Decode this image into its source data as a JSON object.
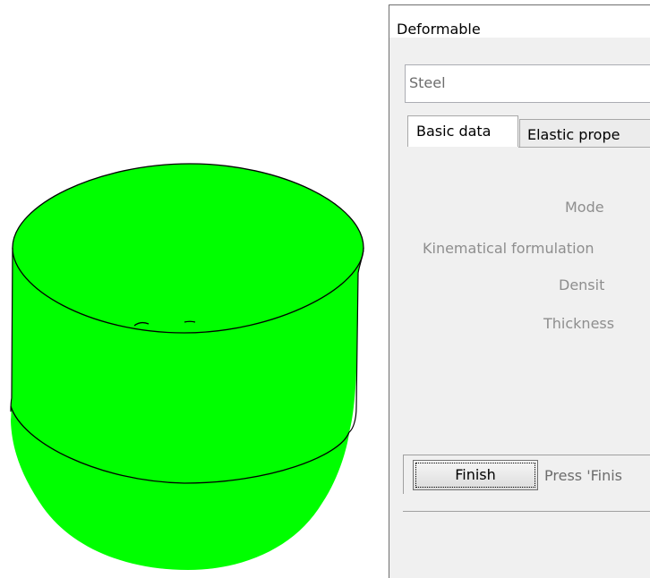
{
  "viewport": {
    "model_color": "#00ff00",
    "outline_color": "#000000",
    "background": "#ffffff"
  },
  "dialog": {
    "title": "Deformable",
    "material_name": "Steel",
    "tabs": [
      {
        "label": "Basic data",
        "active": true
      },
      {
        "label": "Elastic prope",
        "active": false
      }
    ],
    "properties": {
      "model_label": "Mode",
      "kinematical_label": "Kinematical formulation",
      "density_label": "Densit",
      "thickness_label": "Thickness"
    },
    "finish_button_label": "Finish",
    "finish_hint": "Press 'Finis"
  }
}
